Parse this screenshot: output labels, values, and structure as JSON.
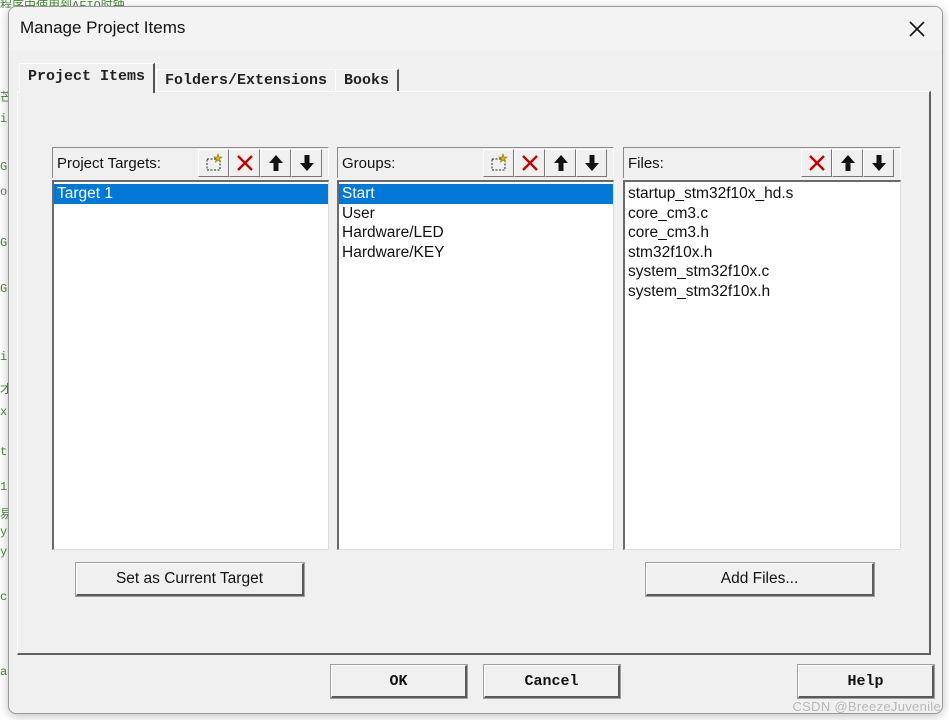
{
  "background": {
    "top_fragment": "程序中使用到AFIO时钟",
    "left_fragments": [
      "芒",
      "i",
      "G",
      "o",
      "G",
      "G",
      "i",
      "才",
      "x",
      "t",
      "1",
      "易",
      "y",
      "y",
      "c",
      "a"
    ]
  },
  "dialog": {
    "title": "Manage Project Items",
    "tabs": [
      {
        "label": "Project Items",
        "active": true
      },
      {
        "label": "Folders/Extensions",
        "active": false
      },
      {
        "label": "Books",
        "active": false
      }
    ],
    "panes": {
      "targets": {
        "label": "Project Targets:",
        "items": [
          "Target 1"
        ],
        "selected": "Target 1",
        "toolbar": [
          "new-icon",
          "delete-icon",
          "move-up-icon",
          "move-down-icon"
        ]
      },
      "groups": {
        "label": "Groups:",
        "items": [
          "Start",
          "User",
          "Hardware/LED",
          "Hardware/KEY"
        ],
        "selected": "Start",
        "toolbar": [
          "new-icon",
          "delete-icon",
          "move-up-icon",
          "move-down-icon"
        ]
      },
      "files": {
        "label": "Files:",
        "items": [
          "startup_stm32f10x_hd.s",
          "core_cm3.c",
          "core_cm3.h",
          "stm32f10x.h",
          "system_stm32f10x.c",
          "system_stm32f10x.h"
        ],
        "toolbar": [
          "delete-icon",
          "move-up-icon",
          "move-down-icon"
        ]
      }
    },
    "buttons": {
      "set_current": "Set as Current Target",
      "add_files": "Add Files...",
      "ok": "OK",
      "cancel": "Cancel",
      "help": "Help"
    },
    "colors": {
      "selection": "#0078d7",
      "delete_red": "#c00000"
    }
  },
  "watermark": "CSDN @BreezeJuvenile"
}
